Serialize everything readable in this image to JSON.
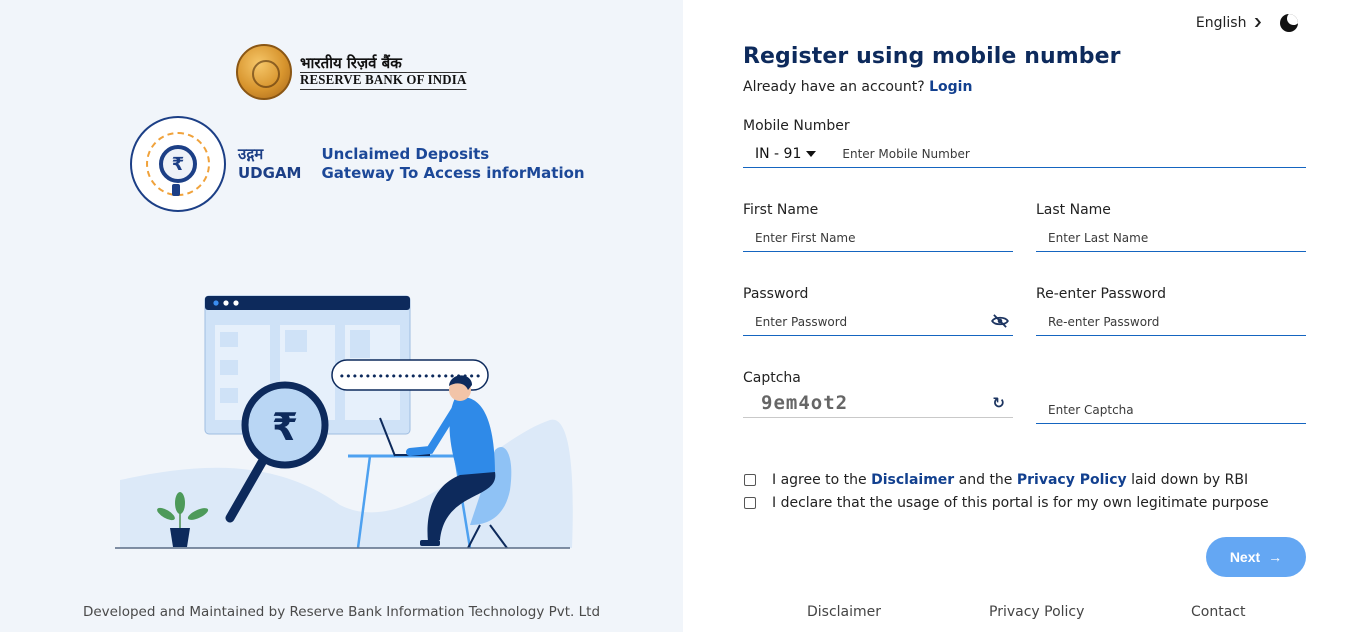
{
  "branding": {
    "rbi_hindi": "भारतीय रिज़र्व बैंक",
    "rbi_english": "RESERVE BANK OF INDIA",
    "udgam_hindi": "उद्गम",
    "udgam_name": "UDGAM",
    "udgam_full_line1": "Unclaimed Deposits",
    "udgam_full_line2": "Gateway To Access inforMation",
    "udgam_seal_symbol": "₹"
  },
  "illustration": {
    "password_dots": "••••••••••••••••••••••",
    "rupee_symbol": "₹"
  },
  "left_footer": "Developed and Maintained by Reserve Bank Information Technology Pvt. Ltd",
  "topbar": {
    "language": "English",
    "language_icon": "chevron-down-icon",
    "theme_icon": "moon-icon"
  },
  "form": {
    "title": "Register using mobile number",
    "already_text": "Already have an account?",
    "login_link": "Login",
    "mobile": {
      "label": "Mobile Number",
      "country_code": "IN - 91",
      "placeholder": "Enter Mobile Number",
      "value": ""
    },
    "first_name": {
      "label": "First Name",
      "placeholder": "Enter First Name",
      "value": ""
    },
    "last_name": {
      "label": "Last Name",
      "placeholder": "Enter Last Name",
      "value": ""
    },
    "password": {
      "label": "Password",
      "placeholder": "Enter Password",
      "value": "",
      "icon": "eye-slash-icon"
    },
    "reenter_password": {
      "label": "Re-enter Password",
      "placeholder": "Re-enter Password",
      "value": ""
    },
    "captcha": {
      "label": "Captcha",
      "code": "9em4ot2",
      "refresh_icon": "↻",
      "placeholder": "Enter Captcha",
      "value": ""
    },
    "agree": {
      "prefix": "I agree to the",
      "disclaimer": "Disclaimer",
      "middle": "and the",
      "privacy": "Privacy Policy",
      "suffix": "laid down by RBI",
      "checked": false
    },
    "declare": {
      "text": "I declare that the usage of this portal is for my own legitimate purpose",
      "checked": false
    },
    "next_label": "Next",
    "next_icon": "→"
  },
  "right_footer": {
    "disclaimer": "Disclaimer",
    "privacy": "Privacy Policy",
    "contact": "Contact"
  },
  "colors": {
    "primary_dark": "#0d2a5c",
    "link": "#12408f",
    "field_underline": "#1565c0",
    "next_button": "#64a7f3",
    "left_bg": "#f1f5fa"
  }
}
